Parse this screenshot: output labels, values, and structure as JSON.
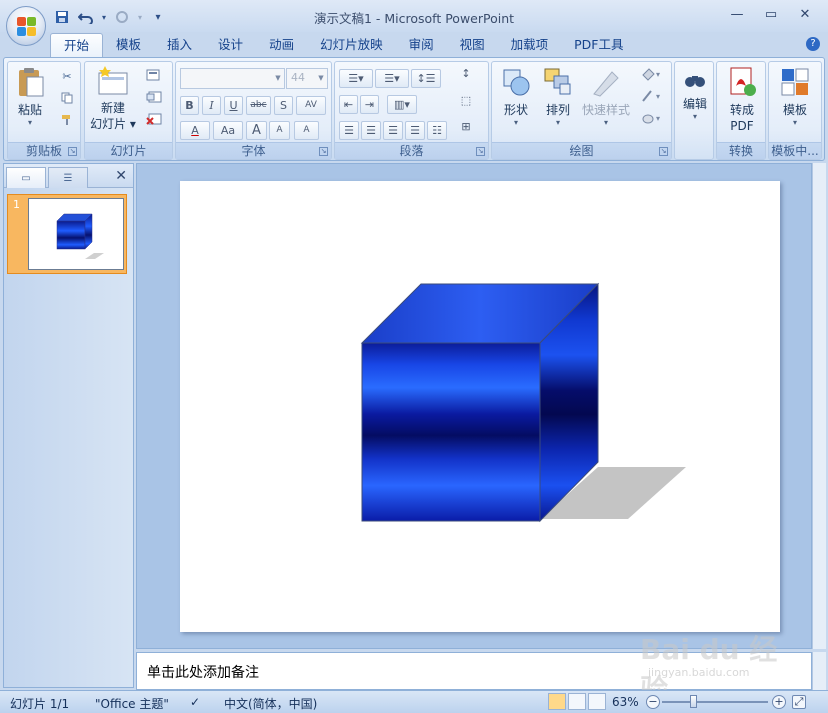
{
  "window": {
    "title": "演示文稿1 - Microsoft PowerPoint"
  },
  "quick_access": {
    "save_icon": "save-icon",
    "undo_icon": "undo-icon",
    "redo_icon": "redo-icon",
    "customize_icon": "customize-icon"
  },
  "tabs": [
    "开始",
    "模板",
    "插入",
    "设计",
    "动画",
    "幻灯片放映",
    "审阅",
    "视图",
    "加载项",
    "PDF工具"
  ],
  "active_tab": "开始",
  "ribbon": {
    "clipboard": {
      "label": "剪贴板",
      "paste": "粘贴"
    },
    "slides": {
      "label": "幻灯片",
      "new_slide_line1": "新建",
      "new_slide_line2": "幻灯片"
    },
    "font": {
      "label": "字体",
      "font_name": "",
      "font_size": "44",
      "bold": "B",
      "italic": "I",
      "underline": "U",
      "strike": "abc",
      "shadow": "S",
      "spacing": "AV",
      "font_color": "A",
      "change_case": "Aa",
      "grow": "A",
      "shrink": "A",
      "clear": "A"
    },
    "paragraph": {
      "label": "段落"
    },
    "drawing": {
      "label": "绘图",
      "shapes": "形状",
      "arrange": "排列",
      "quick_styles": "快速样式"
    },
    "editing": {
      "label": "编辑"
    },
    "convert": {
      "label": "转换",
      "to_pdf_line1": "转成",
      "to_pdf_line2": "PDF"
    },
    "template": {
      "label": "模板中...",
      "template_btn": "模板"
    }
  },
  "slides_pane": {
    "slide_number": "1"
  },
  "notes": {
    "placeholder": "单击此处添加备注"
  },
  "status": {
    "slide_indicator": "幻灯片 1/1",
    "theme": "\"Office 主题\"",
    "language": "中文(简体，中国)",
    "zoom": "63%"
  },
  "zoom_level": 0.63,
  "colors": {
    "cube_front_dark": "#0a1a8c",
    "cube_front_light": "#1f5cff",
    "shadow": "#c8c8c8"
  },
  "watermark": {
    "brand": "Bai du 经验",
    "url": "jingyan.baidu.com"
  }
}
